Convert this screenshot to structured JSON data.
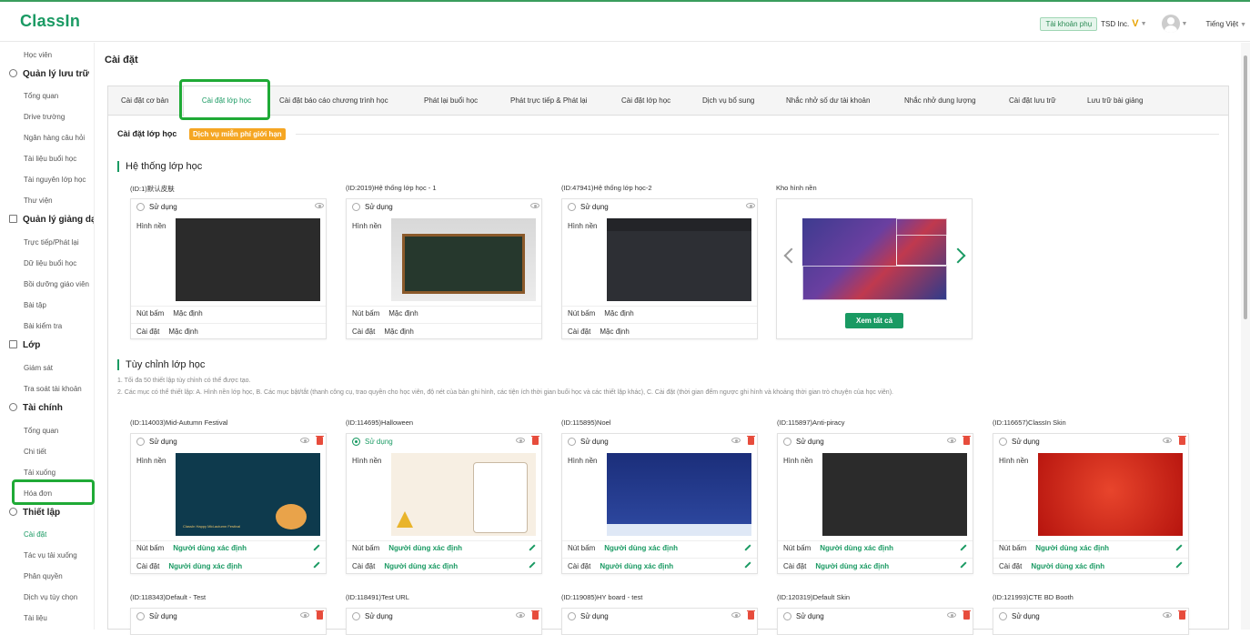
{
  "header": {
    "logo": "ClassIn",
    "sub_account": "Tài khoản phụ",
    "org_name": "TSD Inc.",
    "vip": "V",
    "language": "Tiếng Việt"
  },
  "sidebar": {
    "items": [
      {
        "type": "item",
        "label": "Học viên"
      },
      {
        "type": "group",
        "label": "Quản lý lưu trữ",
        "icon": "cloud-icon"
      },
      {
        "type": "item",
        "label": "Tổng quan"
      },
      {
        "type": "item",
        "label": "Drive trường"
      },
      {
        "type": "item",
        "label": "Ngân hàng câu hỏi"
      },
      {
        "type": "item",
        "label": "Tài liệu buổi học"
      },
      {
        "type": "item",
        "label": "Tài nguyên lớp học"
      },
      {
        "type": "item",
        "label": "Thư viện"
      },
      {
        "type": "group",
        "label": "Quản lý giảng dạ",
        "icon": "teaching-icon"
      },
      {
        "type": "item",
        "label": "Trực tiếp/Phát lại"
      },
      {
        "type": "item",
        "label": "Dữ liệu buổi học"
      },
      {
        "type": "item",
        "label": "Bồi dưỡng giáo viên"
      },
      {
        "type": "item",
        "label": "Bài tập"
      },
      {
        "type": "item",
        "label": "Bài kiểm tra"
      },
      {
        "type": "group",
        "label": "Lớp",
        "icon": "class-icon"
      },
      {
        "type": "item",
        "label": "Giám sát"
      },
      {
        "type": "item",
        "label": "Tra soát tài khoản"
      },
      {
        "type": "group",
        "label": "Tài chính",
        "icon": "finance-icon"
      },
      {
        "type": "item",
        "label": "Tổng quan"
      },
      {
        "type": "item",
        "label": "Chi tiết"
      },
      {
        "type": "item",
        "label": "Tải xuống"
      },
      {
        "type": "item",
        "label": "Hóa đơn"
      },
      {
        "type": "group",
        "label": "Thiết lập",
        "icon": "settings-icon"
      },
      {
        "type": "item",
        "label": "Cài đặt",
        "active": true
      },
      {
        "type": "item",
        "label": "Tác vụ tải xuống"
      },
      {
        "type": "item",
        "label": "Phân quyền"
      },
      {
        "type": "item",
        "label": "Dịch vụ tùy chọn"
      },
      {
        "type": "item",
        "label": "Tài liệu"
      }
    ]
  },
  "page_title": "Cài đặt",
  "tabs": [
    {
      "label": "Cài đặt cơ bản"
    },
    {
      "label": "Cài đặt lớp học",
      "active": true
    },
    {
      "label": "Cài đặt báo cáo chương trình học"
    },
    {
      "label": "Phát lại buổi học"
    },
    {
      "label": "Phát trực tiếp & Phát lại"
    },
    {
      "label": "Cài đặt lớp học"
    },
    {
      "label": "Dịch vụ bổ sung"
    },
    {
      "label": "Nhắc nhở số dư tài khoản"
    },
    {
      "label": "Nhắc nhở dung lượng"
    },
    {
      "label": "Cài đặt lưu trữ"
    },
    {
      "label": "Lưu trữ bài giảng"
    }
  ],
  "section": {
    "title": "Cài đặt lớp học",
    "badge": "Dịch vụ miễn phí giới hạn",
    "accent_color": "#1a9a63"
  },
  "system": {
    "heading": "Hệ thống lớp học",
    "cards": [
      {
        "title": "(ID:1)默认皮肤",
        "use": "Sử dụng",
        "bg_label": "Hình nền",
        "btn_label": "Nút bấm",
        "btn_value": "Mặc định",
        "set_label": "Cài đặt",
        "set_value": "Mặc định"
      },
      {
        "title": "(ID:2019)Hệ thống lớp học - 1",
        "use": "Sử dụng",
        "bg_label": "Hình nền",
        "btn_label": "Nút bấm",
        "btn_value": "Mặc định",
        "set_label": "Cài đặt",
        "set_value": "Mặc định"
      },
      {
        "title": "(ID:47941)Hệ thống lớp học-2",
        "use": "Sử dụng",
        "bg_label": "Hình nền",
        "btn_label": "Nút bấm",
        "btn_value": "Mặc định",
        "set_label": "Cài đặt",
        "set_value": "Mặc định"
      }
    ],
    "library": {
      "title": "Kho hình nền",
      "see_all": "Xem tất cả"
    }
  },
  "custom": {
    "heading": "Tùy chỉnh lớp học",
    "note1": "1. Tối đa 50 thiết lập tùy chỉnh có thể được tạo.",
    "note2": "2. Các mục có thể thiết lập: A. Hình nền lớp học, B. Các mục bật/tắt (thanh công cụ, trao quyền cho học viên, độ nét của bản ghi hình, các tiện ích thời gian buổi học và các thiết lập khác), C. Cài đặt (thời gian đếm ngược ghi hình và khoảng thời gian trò chuyện của học viên).",
    "cards": [
      {
        "title": "(ID:114003)Mid-Autumn Festival",
        "use": "Sử dụng",
        "selected": false,
        "bg_label": "Hình nền",
        "btn_label": "Nút bấm",
        "btn_value": "Người dùng xác định",
        "set_label": "Cài đặt",
        "set_value": "Người dùng xác định",
        "thumb_text": "ClassIn Happy Mid-autumn Festival"
      },
      {
        "title": "(ID:114695)Halloween",
        "use": "Sử dụng",
        "selected": true,
        "bg_label": "Hình nền",
        "btn_label": "Nút bấm",
        "btn_value": "Người dùng xác định",
        "set_label": "Cài đặt",
        "set_value": "Người dùng xác định"
      },
      {
        "title": "(ID:115895)Noel",
        "use": "Sử dụng",
        "selected": false,
        "bg_label": "Hình nền",
        "btn_label": "Nút bấm",
        "btn_value": "Người dùng xác định",
        "set_label": "Cài đặt",
        "set_value": "Người dùng xác định"
      },
      {
        "title": "(ID:115897)Anti-piracy",
        "use": "Sử dụng",
        "selected": false,
        "bg_label": "Hình nền",
        "btn_label": "Nút bấm",
        "btn_value": "Người dùng xác định",
        "set_label": "Cài đặt",
        "set_value": "Người dùng xác định"
      },
      {
        "title": "(ID:116657)ClassIn Skin",
        "use": "Sử dụng",
        "selected": false,
        "bg_label": "Hình nền",
        "btn_label": "Nút bấm",
        "btn_value": "Người dùng xác định",
        "set_label": "Cài đặt",
        "set_value": "Người dùng xác định"
      }
    ],
    "cards2": [
      {
        "title": "(ID:118343)Default - Test",
        "use": "Sử dụng"
      },
      {
        "title": "(ID:118491)Test URL",
        "use": "Sử dụng"
      },
      {
        "title": "(ID:119085)HY board - test",
        "use": "Sử dụng"
      },
      {
        "title": "(ID:120319)Default Skin",
        "use": "Sử dụng"
      },
      {
        "title": "(ID:121993)CTE BD Booth",
        "use": "Sử dụng"
      }
    ]
  }
}
